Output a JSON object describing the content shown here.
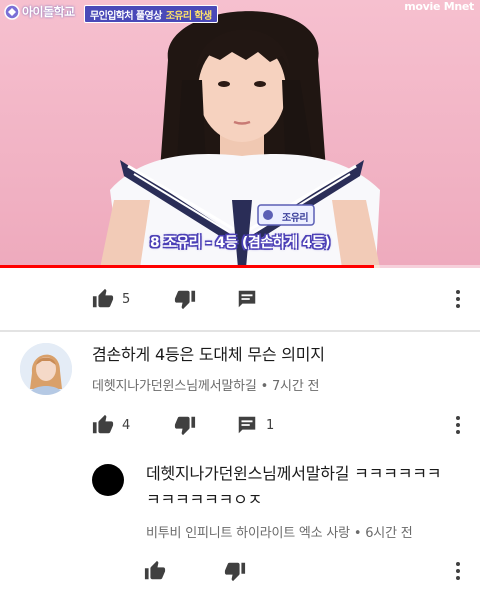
{
  "video": {
    "channel_logo_text": "아이돌학교",
    "caption_tag_main": "무인입학처 풀영상",
    "caption_tag_name": "조유리 학생",
    "broadcaster": "movie Mnet",
    "nametag": "조유리",
    "subtitle": "8 조유리 - 4등 (겸손하게 4등)",
    "progress_fraction": 0.78
  },
  "post_actions": {
    "like_count": "5",
    "dislike_label": "",
    "reply_label": ""
  },
  "comments": [
    {
      "text": "겸손하게 4등은 도대체 무슨 의미지",
      "author": "데헷지나가던윈스님께서말하길",
      "time": "7시간 전",
      "like_count": "4",
      "reply_count": "1"
    },
    {
      "text_line1": "데헷지나가던윈스님께서말하길 ㅋㅋㅋㅋㅋㅋ",
      "text_line2": "ㅋㅋㅋㅋㅋㅋㅇㅈ",
      "author": "비투비 인피니트 하이라이트 엑소 사랑",
      "time": "6시간 전"
    }
  ],
  "separator": "•",
  "colors": {
    "accent_red": "#ff0000",
    "icon_gray": "#404040",
    "meta_gray": "#6b6b6b",
    "tag_purple": "#4a49b8"
  },
  "icons": [
    "thumb-up-icon",
    "thumb-down-icon",
    "comment-icon",
    "more-vert-icon"
  ]
}
